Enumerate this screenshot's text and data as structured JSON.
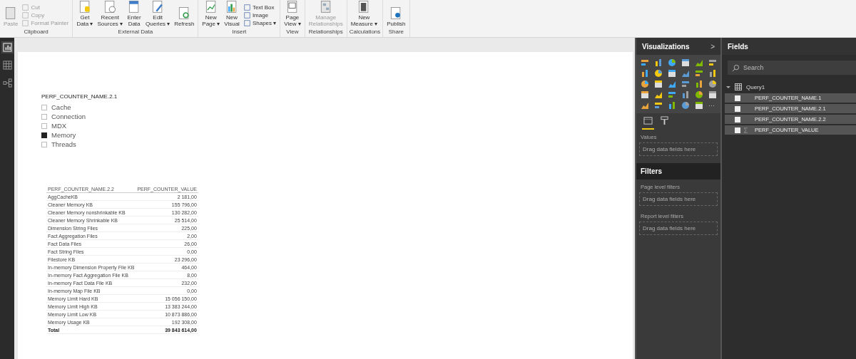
{
  "ribbon": {
    "groups": [
      {
        "label": "Clipboard",
        "items": [
          {
            "kind": "large",
            "lines": [
              "Paste"
            ],
            "disabled": true
          },
          {
            "kind": "stack",
            "entries": [
              {
                "label": "Cut",
                "disabled": true
              },
              {
                "label": "Copy",
                "disabled": true
              },
              {
                "label": "Format Painter",
                "disabled": true
              }
            ]
          }
        ]
      },
      {
        "label": "External Data",
        "items": [
          {
            "kind": "large",
            "lines": [
              "Get",
              "Data ▾"
            ],
            "disabled": false
          },
          {
            "kind": "large",
            "lines": [
              "Recent",
              "Sources ▾"
            ],
            "disabled": false
          },
          {
            "kind": "large",
            "lines": [
              "Enter",
              "Data"
            ],
            "disabled": false
          },
          {
            "kind": "large",
            "lines": [
              "Edit",
              "Queries ▾"
            ],
            "disabled": false
          },
          {
            "kind": "large",
            "lines": [
              "Refresh"
            ],
            "disabled": false
          }
        ]
      },
      {
        "label": "Insert",
        "items": [
          {
            "kind": "large",
            "lines": [
              "New",
              "Page ▾"
            ],
            "disabled": false
          },
          {
            "kind": "large",
            "lines": [
              "New",
              "Visual"
            ],
            "disabled": false
          },
          {
            "kind": "stack",
            "entries": [
              {
                "label": "Text Box",
                "disabled": false
              },
              {
                "label": "Image",
                "disabled": false
              },
              {
                "label": "Shapes ▾",
                "disabled": false
              }
            ]
          }
        ]
      },
      {
        "label": "View",
        "items": [
          {
            "kind": "large",
            "lines": [
              "Page",
              "View ▾"
            ],
            "disabled": false
          }
        ]
      },
      {
        "label": "Relationships",
        "items": [
          {
            "kind": "large",
            "lines": [
              "Manage",
              "Relationships"
            ],
            "disabled": true
          }
        ]
      },
      {
        "label": "Calculations",
        "items": [
          {
            "kind": "large",
            "lines": [
              "New",
              "Measure ▾"
            ],
            "disabled": false
          }
        ]
      },
      {
        "label": "Share",
        "items": [
          {
            "kind": "large",
            "lines": [
              "Publish"
            ],
            "disabled": false
          }
        ]
      }
    ]
  },
  "nav": [
    {
      "kind": "report",
      "selected": true
    },
    {
      "kind": "data",
      "selected": false
    },
    {
      "kind": "model",
      "selected": false
    }
  ],
  "slicer": {
    "title": "PERF_COUNTER_NAME.2.1",
    "items": [
      {
        "label": "Cache",
        "checked": false
      },
      {
        "label": "Connection",
        "checked": false
      },
      {
        "label": "MDX",
        "checked": false
      },
      {
        "label": "Memory",
        "checked": true
      },
      {
        "label": "Threads",
        "checked": false
      }
    ]
  },
  "table": {
    "columns": [
      "PERF_COUNTER_NAME.2.2",
      "PERF_COUNTER_VALUE"
    ],
    "rows": [
      [
        "AggCacheKB",
        "2 181,00"
      ],
      [
        "Cleaner Memory KB",
        "155 796,00"
      ],
      [
        "Cleaner Memory nonshrinkable KB",
        "130 282,00"
      ],
      [
        "Cleaner Memory Shrinkable KB",
        "25 514,00"
      ],
      [
        "Dimension String Files",
        "225,00"
      ],
      [
        "Fact Aggregation Files",
        "2,00"
      ],
      [
        "Fact Data Files",
        "26,00"
      ],
      [
        "Fact String Files",
        "0,00"
      ],
      [
        "Filestore KB",
        "23 296,00"
      ],
      [
        "In-memory Dimension Property File KB",
        "464,00"
      ],
      [
        "In-memory Fact Aggregation File KB",
        "8,00"
      ],
      [
        "In-memory Fact Data File KB",
        "232,00"
      ],
      [
        "In-memory Map File KB",
        "0,00"
      ],
      [
        "Memory Limit Hard KB",
        "15 056 150,00"
      ],
      [
        "Memory Limit High KB",
        "13 383 244,00"
      ],
      [
        "Memory Limit Low KB",
        "10 873 886,00"
      ],
      [
        "Memory Usage KB",
        "192 308,00"
      ]
    ],
    "total": [
      "Total",
      "39 843 614,00"
    ]
  },
  "visualizations": {
    "title": "Visualizations",
    "collapse": ">",
    "more": "···",
    "tabs": [
      {
        "kind": "fields",
        "selected": true
      },
      {
        "kind": "format",
        "selected": false
      }
    ],
    "values_label": "Values",
    "values_drop": "Drag data fields here"
  },
  "filters": {
    "title": "Filters",
    "sections": [
      {
        "label": "Page level filters",
        "drop": "Drag data fields here"
      },
      {
        "label": "Report level filters",
        "drop": "Drag data fields here"
      }
    ]
  },
  "fields": {
    "title": "Fields",
    "search": {
      "placeholder": "Search"
    },
    "tree": [
      {
        "label": "Query1",
        "expanded": true,
        "children": [
          {
            "label": "PERF_COUNTER_NAME.1",
            "kind": "column",
            "checked": false
          },
          {
            "label": "PERF_COUNTER_NAME.2.1",
            "kind": "column",
            "checked": false
          },
          {
            "label": "PERF_COUNTER_NAME.2.2",
            "kind": "column",
            "checked": false
          },
          {
            "label": "PERF_COUNTER_VALUE",
            "kind": "measure",
            "checked": false
          }
        ]
      }
    ]
  }
}
